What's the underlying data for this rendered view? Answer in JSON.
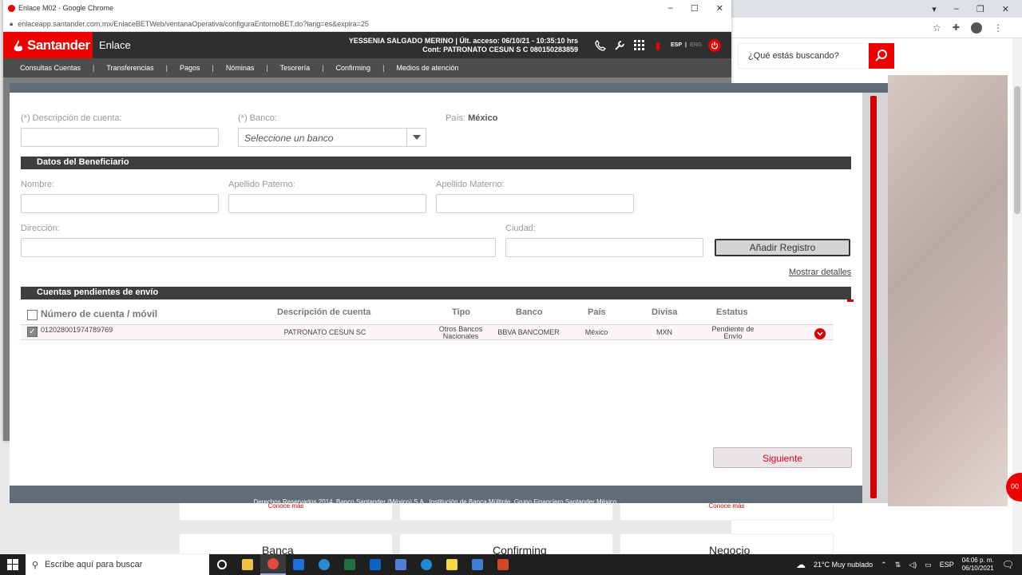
{
  "popup": {
    "window_title": "Enlace M02 - Google Chrome",
    "url": "enlaceapp.santander.com.mx/EnlaceBETWeb/ventanaOperativa/configuraEntornoBET.do?lang=es&expira=25"
  },
  "header": {
    "brand": "Santander",
    "product": "Enlace",
    "user_line1": "YESSENIA SALGADO MERINO | Últ. acceso: 06/10/21 - 10:35:10 hrs",
    "user_line2": "Cont: PATRONATO CESUN S C 080150283859",
    "lang_esp": "ESP",
    "lang_sep": "|",
    "lang_eng": "ENG"
  },
  "nav": {
    "items": [
      "Consultas Cuentas",
      "Transferencias",
      "Pagos",
      "Nóminas",
      "Tesorería",
      "Confirming",
      "Medios de atención"
    ],
    "separator": "|"
  },
  "form": {
    "desc_label": "(*) Descripción de cuenta:",
    "banco_label": "(*) Banco:",
    "banco_value": "Seleccione un banco",
    "pais_label": "País:",
    "pais_value": "México"
  },
  "beneficiario": {
    "section_title": "Datos del Beneficiario",
    "nombre_label": "Nombre:",
    "ap_paterno_label": "Apellido Paterno:",
    "ap_materno_label": "Apellido Materno:",
    "direccion_label": "Dirección:",
    "ciudad_label": "Ciudad:",
    "add_button": "Añadir Registro",
    "details_link": "Mostrar detalles"
  },
  "pending": {
    "section_title": "Cuentas pendientes de envío",
    "columns": [
      "Número de cuenta / móvil",
      "Descripción de cuenta",
      "Tipo",
      "Banco",
      "País",
      "Divisa",
      "Estatus"
    ],
    "rows": [
      {
        "cuenta": "012028001974789769",
        "descripcion": "PATRONATO CESUN SC",
        "tipo_1": "Otros Bancos",
        "tipo_2": "Nacionales",
        "banco": "BBVA BANCOMER",
        "pais": "México",
        "divisa": "MXN",
        "estatus_1": "Pendiente de",
        "estatus_2": "Envío",
        "checked": true
      }
    ],
    "next_button": "Siguiente"
  },
  "footer": "Derechos Reservados 2014. Banco Santander (México) S.A., Institución de Banca Múltiple, Grupo Financiero Santander México.",
  "background_page": {
    "search_placeholder": "¿Qué estás buscando?",
    "card_link": "Conoce más",
    "cards": [
      "Banca",
      "Confirming",
      "Negocio"
    ],
    "bubble": "00"
  },
  "taskbar": {
    "search_placeholder": "Escribe aquí para buscar",
    "weather": "21°C  Muy nublado",
    "lang": "ESP",
    "time": "04:06 p. m.",
    "date": "06/10/2021"
  },
  "colors": {
    "brand_red": "#ec0000",
    "header_dark": "#2f2f2f",
    "nav_gray": "#4d4d4d",
    "section_bar": "#3d3d3d"
  }
}
